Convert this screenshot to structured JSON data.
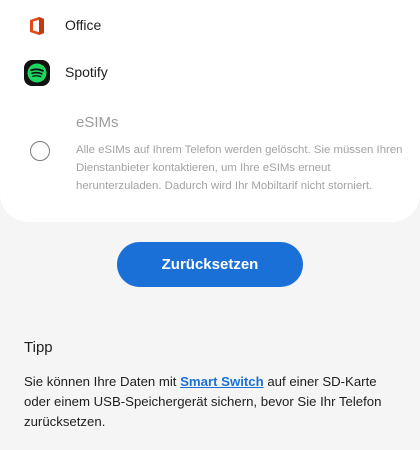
{
  "apps": [
    {
      "label": "Office",
      "icon": "office-icon"
    },
    {
      "label": "Spotify",
      "icon": "spotify-icon"
    }
  ],
  "esim": {
    "title": "eSIMs",
    "description": "Alle eSIMs auf Ihrem Telefon werden gelöscht. Sie müssen Ihren Dienstanbieter kontaktieren, um Ihre eSIMs erneut herunterzuladen. Dadurch wird Ihr Mobiltarif nicht storniert.",
    "checked": false
  },
  "reset_button": {
    "label": "Zurücksetzen"
  },
  "tip": {
    "title": "Tipp",
    "text_before": "Sie können Ihre Daten mit ",
    "link": "Smart Switch",
    "text_after": " auf einer SD-Karte oder einem USB-Speichergerät sichern, bevor Sie Ihr Telefon zurücksetzen."
  },
  "colors": {
    "accent": "#1b70d8",
    "office_red": "#e64a19",
    "spotify_green": "#1ed760",
    "background": "#f5f5f5"
  }
}
